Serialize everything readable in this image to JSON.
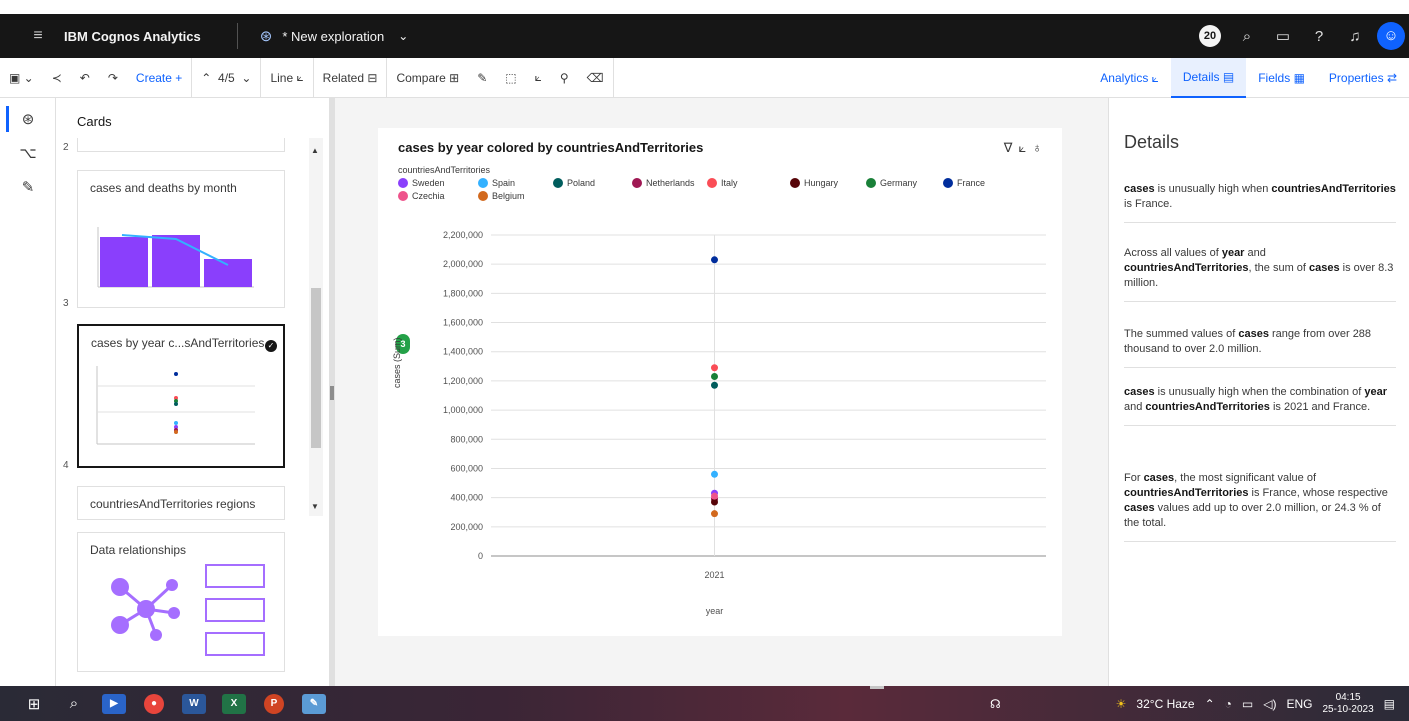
{
  "header": {
    "app_name": "IBM Cognos Analytics",
    "exploration_title": "* New exploration",
    "badge_count": "20"
  },
  "toolbar": {
    "create_label": "Create +",
    "page_indicator": "4/5",
    "line_label": "Line",
    "related_label": "Related",
    "compare_label": "Compare",
    "right_tabs": [
      "Analytics",
      "Details",
      "Fields",
      "Properties"
    ],
    "active_tab": "Details"
  },
  "cards_panel": {
    "title": "Cards",
    "items": [
      {
        "index": "2",
        "label": "cases and deaths by month"
      },
      {
        "index": "3",
        "label": "cases by year c...sAndTerritories"
      },
      {
        "index": "4",
        "label": "countriesAndTerritories regions"
      },
      {
        "index": "",
        "label": "Data relationships"
      }
    ]
  },
  "viz": {
    "title": "cases by year colored by countriesAndTerritories",
    "legend_title": "countriesAndTerritories",
    "y_axis_label": "cases (Sum)",
    "y_badge": "3",
    "x_axis_label": "year"
  },
  "chart_data": {
    "type": "scatter",
    "title": "cases by year colored by countriesAndTerritories",
    "xlabel": "year",
    "ylabel": "cases (Sum)",
    "categories": [
      "2021"
    ],
    "ylim": [
      0,
      2200000
    ],
    "yticks": [
      "0",
      "200,000",
      "400,000",
      "600,000",
      "800,000",
      "1,000,000",
      "1,200,000",
      "1,400,000",
      "1,600,000",
      "1,800,000",
      "2,000,000",
      "2,200,000"
    ],
    "legend_position": "top-left",
    "grid": true,
    "series": [
      {
        "name": "Sweden",
        "color": "#8a3ffc",
        "values": [
          430000
        ]
      },
      {
        "name": "Spain",
        "color": "#33b1ff",
        "values": [
          560000
        ]
      },
      {
        "name": "Poland",
        "color": "#005d5d",
        "values": [
          1170000
        ]
      },
      {
        "name": "Netherlands",
        "color": "#9f1853",
        "values": [
          390000
        ]
      },
      {
        "name": "Italy",
        "color": "#fa4d56",
        "values": [
          1290000
        ]
      },
      {
        "name": "Hungary",
        "color": "#570408",
        "values": [
          370000
        ]
      },
      {
        "name": "Germany",
        "color": "#198038",
        "values": [
          1230000
        ]
      },
      {
        "name": "France",
        "color": "#002d9c",
        "values": [
          2030000
        ]
      },
      {
        "name": "Czechia",
        "color": "#ee538b",
        "values": [
          410000
        ]
      },
      {
        "name": "Belgium",
        "color": "#d2691e",
        "values": [
          290000
        ]
      }
    ]
  },
  "details": {
    "title": "Details",
    "insights": [
      {
        "parts": [
          [
            "b",
            "cases"
          ],
          [
            "t",
            " is unusually high when "
          ],
          [
            "b",
            "countriesAndTerritories"
          ],
          [
            "t",
            " is France."
          ]
        ]
      },
      {
        "parts": [
          [
            "t",
            "Across all values of "
          ],
          [
            "b",
            "year"
          ],
          [
            "t",
            " and "
          ],
          [
            "b",
            "countriesAndTerritories"
          ],
          [
            "t",
            ", the sum of "
          ],
          [
            "b",
            "cases"
          ],
          [
            "t",
            " is over 8.3 million."
          ]
        ]
      },
      {
        "parts": [
          [
            "t",
            "The summed values of "
          ],
          [
            "b",
            "cases"
          ],
          [
            "t",
            " range from over 288 thousand to over 2.0 million."
          ]
        ]
      },
      {
        "parts": [
          [
            "b",
            "cases"
          ],
          [
            "t",
            " is unusually high when the combination of "
          ],
          [
            "b",
            "year"
          ],
          [
            "t",
            " and "
          ],
          [
            "b",
            "countriesAndTerritories"
          ],
          [
            "t",
            " is 2021 and France."
          ]
        ]
      },
      {
        "parts": [
          [
            "t",
            "For "
          ],
          [
            "b",
            "cases"
          ],
          [
            "t",
            ", the most significant value of "
          ],
          [
            "b",
            "countriesAndTerritories"
          ],
          [
            "t",
            " is France, whose respective "
          ],
          [
            "b",
            "cases"
          ],
          [
            "t",
            " values add up to over 2.0 million, or 24.3 % of the total."
          ]
        ]
      }
    ]
  },
  "taskbar": {
    "weather": "32°C Haze",
    "language": "ENG",
    "time": "04:15",
    "date": "25-10-2023"
  }
}
